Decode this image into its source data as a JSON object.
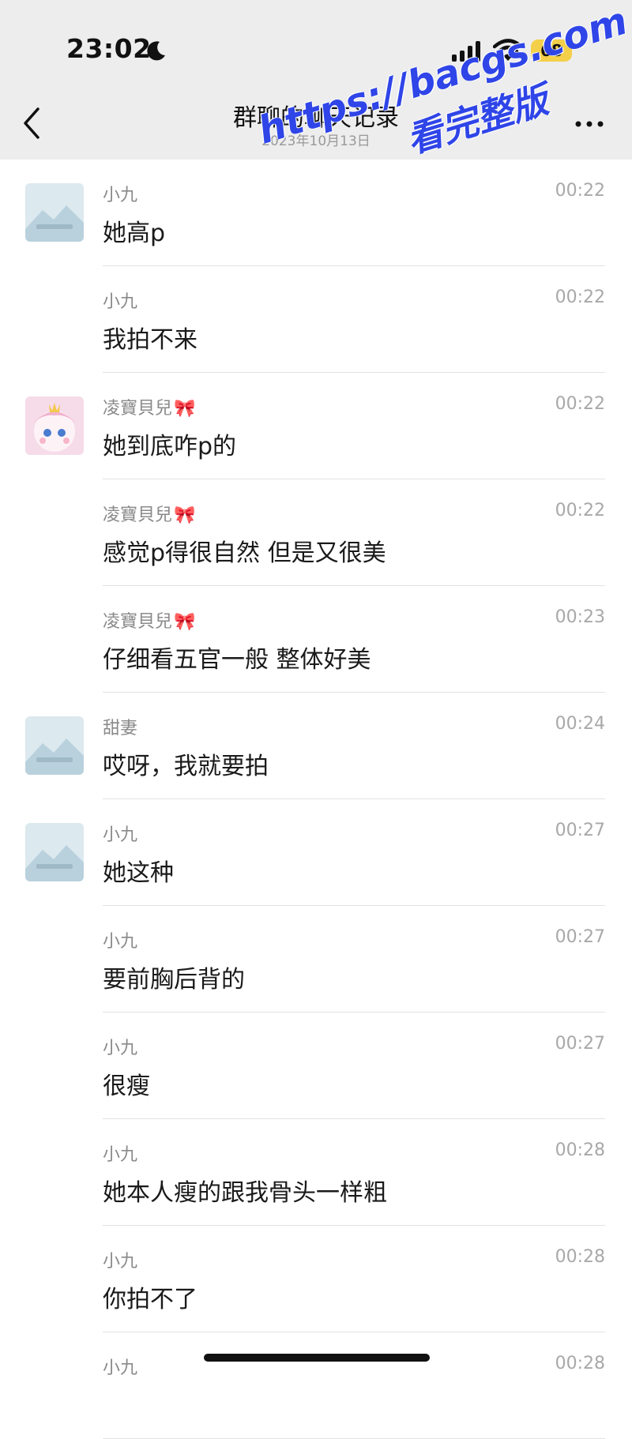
{
  "status_bar": {
    "time": "23:02",
    "battery": "68"
  },
  "nav": {
    "title": "群聊的聊天记录",
    "date": "2023年10月13日"
  },
  "watermark": {
    "url": "https://bacgs.com",
    "subtitle": "看完整版"
  },
  "messages": [
    {
      "sender": "小九",
      "bow": "",
      "time": "00:22",
      "text": "她高p",
      "avatar": "placeholder"
    },
    {
      "sender": "小九",
      "bow": "",
      "time": "00:22",
      "text": "我拍不来",
      "avatar": "none"
    },
    {
      "sender": "凌寶貝兒",
      "bow": "🎀",
      "time": "00:22",
      "text": "她到底咋p的",
      "avatar": "anime"
    },
    {
      "sender": "凌寶貝兒",
      "bow": "🎀",
      "time": "00:22",
      "text": "感觉p得很自然 但是又很美",
      "avatar": "none"
    },
    {
      "sender": "凌寶貝兒",
      "bow": "🎀",
      "time": "00:23",
      "text": "仔细看五官一般 整体好美",
      "avatar": "none"
    },
    {
      "sender": "甜妻",
      "bow": "",
      "time": "00:24",
      "text": "哎呀，我就要拍",
      "avatar": "placeholder"
    },
    {
      "sender": "小九",
      "bow": "",
      "time": "00:27",
      "text": "她这种",
      "avatar": "placeholder"
    },
    {
      "sender": "小九",
      "bow": "",
      "time": "00:27",
      "text": "要前胸后背的",
      "avatar": "none"
    },
    {
      "sender": "小九",
      "bow": "",
      "time": "00:27",
      "text": "很瘦",
      "avatar": "none"
    },
    {
      "sender": "小九",
      "bow": "",
      "time": "00:28",
      "text": "她本人瘦的跟我骨头一样粗",
      "avatar": "none"
    },
    {
      "sender": "小九",
      "bow": "",
      "time": "00:28",
      "text": "你拍不了",
      "avatar": "none"
    },
    {
      "sender": "小九",
      "bow": "",
      "time": "00:28",
      "text": "",
      "avatar": "none"
    }
  ]
}
